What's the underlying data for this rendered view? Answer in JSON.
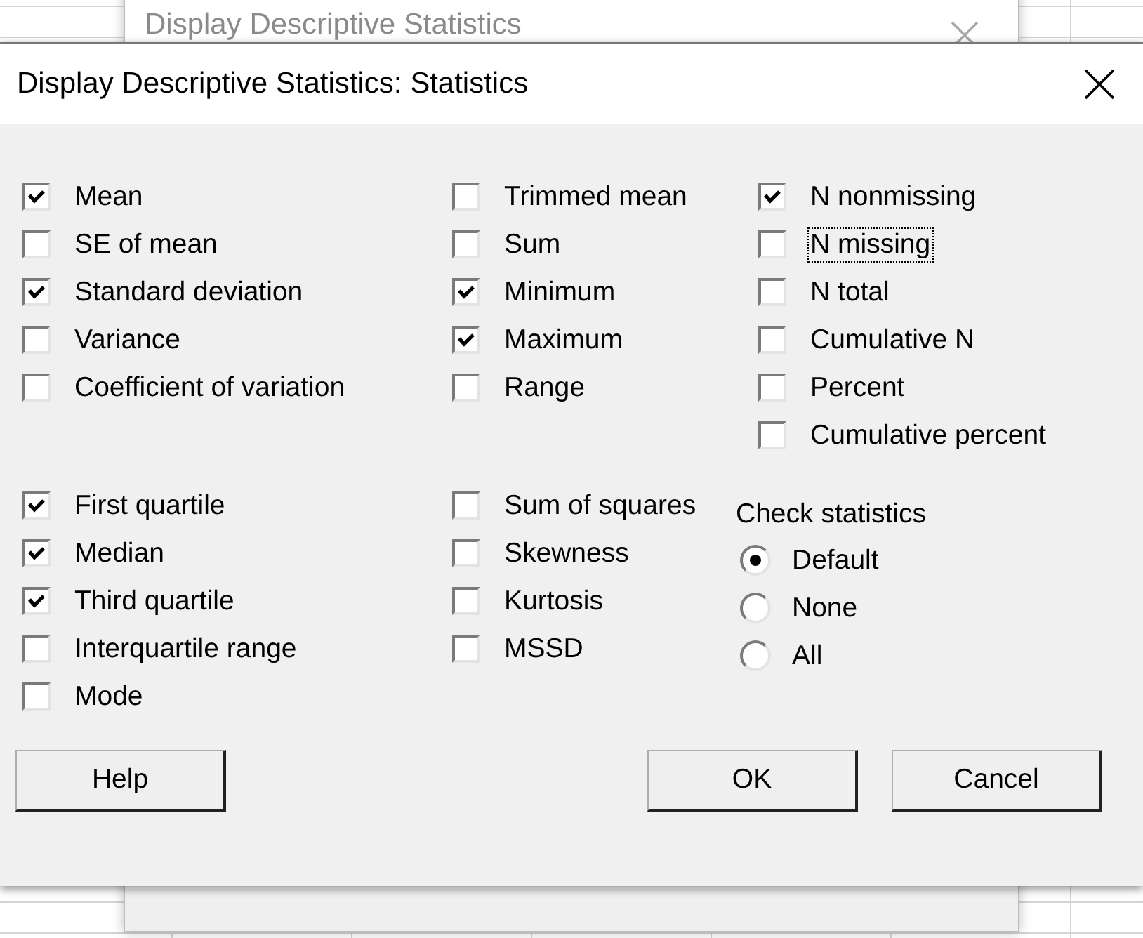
{
  "background_window": {
    "title": "Display Descriptive Statistics"
  },
  "dialog": {
    "title": "Display Descriptive Statistics: Statistics"
  },
  "sections": [
    {
      "columns": [
        {
          "kind": "checkboxes",
          "items": [
            {
              "label": "Mean",
              "checked": true,
              "focused": false
            },
            {
              "label": "SE of mean",
              "checked": false,
              "focused": false
            },
            {
              "label": "Standard deviation",
              "checked": true,
              "focused": false
            },
            {
              "label": "Variance",
              "checked": false,
              "focused": false
            },
            {
              "label": "Coefficient of variation",
              "checked": false,
              "focused": false
            }
          ]
        },
        {
          "kind": "checkboxes",
          "items": [
            {
              "label": "Trimmed mean",
              "checked": false,
              "focused": false
            },
            {
              "label": "Sum",
              "checked": false,
              "focused": false
            },
            {
              "label": "Minimum",
              "checked": true,
              "focused": false
            },
            {
              "label": "Maximum",
              "checked": true,
              "focused": false
            },
            {
              "label": "Range",
              "checked": false,
              "focused": false
            }
          ]
        },
        {
          "kind": "checkboxes",
          "items": [
            {
              "label": "N nonmissing",
              "checked": true,
              "focused": false
            },
            {
              "label": "N missing",
              "checked": false,
              "focused": true
            },
            {
              "label": "N total",
              "checked": false,
              "focused": false
            },
            {
              "label": "Cumulative N",
              "checked": false,
              "focused": false
            },
            {
              "label": "Percent",
              "checked": false,
              "focused": false
            },
            {
              "label": "Cumulative percent",
              "checked": false,
              "focused": false
            }
          ]
        }
      ]
    },
    {
      "columns": [
        {
          "kind": "checkboxes",
          "items": [
            {
              "label": "First quartile",
              "checked": true,
              "focused": false
            },
            {
              "label": "Median",
              "checked": true,
              "focused": false
            },
            {
              "label": "Third quartile",
              "checked": true,
              "focused": false
            },
            {
              "label": "Interquartile range",
              "checked": false,
              "focused": false
            },
            {
              "label": "Mode",
              "checked": false,
              "focused": false
            }
          ]
        },
        {
          "kind": "checkboxes",
          "items": [
            {
              "label": "Sum of squares",
              "checked": false,
              "focused": false
            },
            {
              "label": "Skewness",
              "checked": false,
              "focused": false
            },
            {
              "label": "Kurtosis",
              "checked": false,
              "focused": false
            },
            {
              "label": "MSSD",
              "checked": false,
              "focused": false
            }
          ]
        },
        {
          "kind": "radio_group",
          "title": "Check statistics",
          "options": [
            {
              "label": "Default",
              "selected": true
            },
            {
              "label": "None",
              "selected": false
            },
            {
              "label": "All",
              "selected": false
            }
          ]
        }
      ]
    }
  ],
  "buttons": [
    {
      "label": "Help"
    },
    {
      "label": "OK"
    },
    {
      "label": "Cancel"
    }
  ]
}
